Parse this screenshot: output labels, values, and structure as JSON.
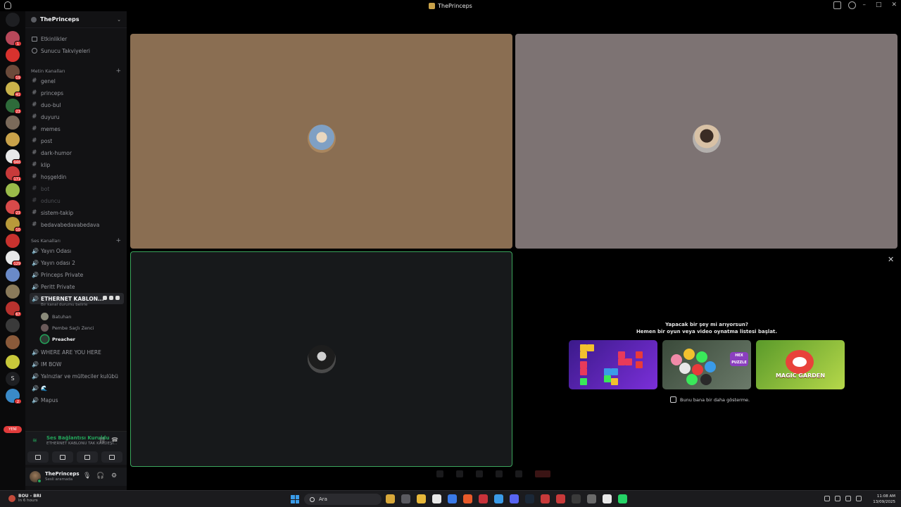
{
  "window": {
    "title": "ThePrinceps"
  },
  "server": {
    "name": "ThePrinceps"
  },
  "sidebar": {
    "top_items": [
      {
        "label": "Etkinlikler",
        "icon": "calendar-icon"
      },
      {
        "label": "Sunucu Takviyeleri",
        "icon": "boost-icon"
      }
    ],
    "text_category": "Metin Kanalları",
    "text_channels": [
      {
        "label": "genel",
        "muted": false
      },
      {
        "label": "princeps",
        "muted": false
      },
      {
        "label": "duo-bul",
        "muted": false
      },
      {
        "label": "duyuru",
        "muted": false
      },
      {
        "label": "memes",
        "muted": false
      },
      {
        "label": "post",
        "muted": false
      },
      {
        "label": "dark-humor",
        "muted": false
      },
      {
        "label": "klip",
        "muted": false
      },
      {
        "label": "hoşgeldin",
        "muted": false
      },
      {
        "label": "bot",
        "muted": true
      },
      {
        "label": "oduncu",
        "muted": true
      },
      {
        "label": "sistem-takip",
        "muted": false
      },
      {
        "label": "bedavabedavabedava",
        "muted": false
      }
    ],
    "voice_category": "Ses Kanalları",
    "voice_channels_before": [
      {
        "label": "Yayın Odası"
      },
      {
        "label": "Yayın odası 2"
      },
      {
        "label": "Princeps Private"
      },
      {
        "label": "Peritt Private"
      }
    ],
    "active_voice_channel": {
      "label": "ETHERNET KABLON...",
      "status": "Bir kanal durumu belirle"
    },
    "voice_users": [
      {
        "name": "Batuhan",
        "speaking": false
      },
      {
        "name": "Pembe Saçlı Zenci",
        "speaking": false
      },
      {
        "name": "Preacher",
        "speaking": true
      }
    ],
    "voice_channels_after": [
      {
        "label": "WHERE ARE YOU HERE"
      },
      {
        "label": "IM BOW"
      },
      {
        "label": "Yalnızlar ve mülteciler kulübü"
      },
      {
        "label": "🌊"
      },
      {
        "label": "Mapus"
      }
    ]
  },
  "rail": {
    "letter_server": "S",
    "new_label": "YENİ",
    "badges": [
      "1",
      "",
      "19",
      "41",
      "23",
      "",
      "",
      "946",
      "171",
      "",
      "23",
      "10",
      "",
      "129",
      "",
      "",
      "67",
      "",
      "",
      "",
      "2"
    ]
  },
  "voice_panel": {
    "connected_label": "Ses Bağlantısı Kuruldu",
    "channel_label": "ETHERNET KABLONU TAK KARDEŞİ..."
  },
  "user_panel": {
    "name": "ThePrinceps",
    "status": "Sesli aramada"
  },
  "activity": {
    "title_line1": "Yapacak bir şey mi arıyorsun?",
    "title_line2": "Hemen bir oyun veya video oynatma listesi başlat.",
    "games": [
      {
        "label": ""
      },
      {
        "label": "HEX PUZZLE"
      },
      {
        "label": "MAGIC GARDEN"
      }
    ],
    "dont_show": "Bunu bana bir daha gösterme."
  },
  "taskbar": {
    "weather_title": "BOU - BRI",
    "weather_sub": "In 6 hours",
    "search_placeholder": "Ara",
    "time": "11:08 AM",
    "date": "13/09/2025"
  },
  "colors": {
    "speaking_green": "#23a55a",
    "badge_red": "#e03b3b",
    "tile1": "#8a6e52",
    "tile2": "#7d7373",
    "tile3": "#17191b"
  }
}
